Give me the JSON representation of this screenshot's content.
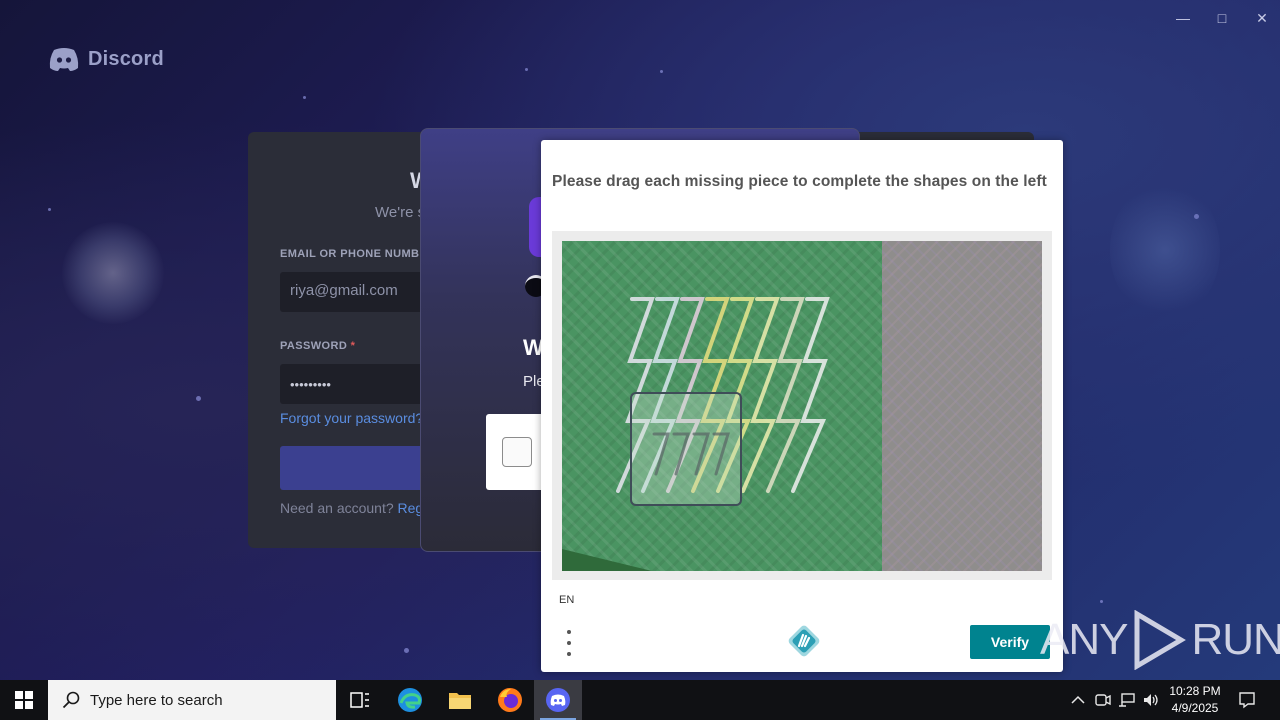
{
  "window": {
    "minimize_icon": "minimize-icon",
    "maximize_icon": "maximize-icon",
    "close_icon": "close-icon"
  },
  "discord": {
    "wordmark": "Discord"
  },
  "login": {
    "title_fragment": "W",
    "subtitle_fragment": "We're s",
    "email_label": "EMAIL OR PHONE NUMBE",
    "email_value": "riya@gmail.com",
    "password_label": "PASSWORD",
    "password_required": "*",
    "password_value": "•••••••••",
    "forgot_link": "Forgot your password?",
    "need_account": "Need an account?",
    "register_fragment": "Regis"
  },
  "overlay": {
    "heading_fragment": "W",
    "text_fragment": "Ple"
  },
  "captcha": {
    "prompt": "Please drag each missing piece to complete the shapes on the left",
    "language": "EN",
    "verify_label": "Verify",
    "menu_icon": "more-vertical-icon",
    "logo_icon": "hcaptcha-logo-icon",
    "accent_color": "#00838f"
  },
  "watermark": {
    "text_left": "ANY",
    "text_right": "RUN"
  },
  "taskbar": {
    "search_placeholder": "Type here to search",
    "clock_time": "10:28 PM",
    "clock_date": "4/9/2025",
    "apps": [
      "start-icon",
      "task-view-icon",
      "edge-icon",
      "file-explorer-icon",
      "firefox-icon",
      "discord-icon"
    ]
  }
}
